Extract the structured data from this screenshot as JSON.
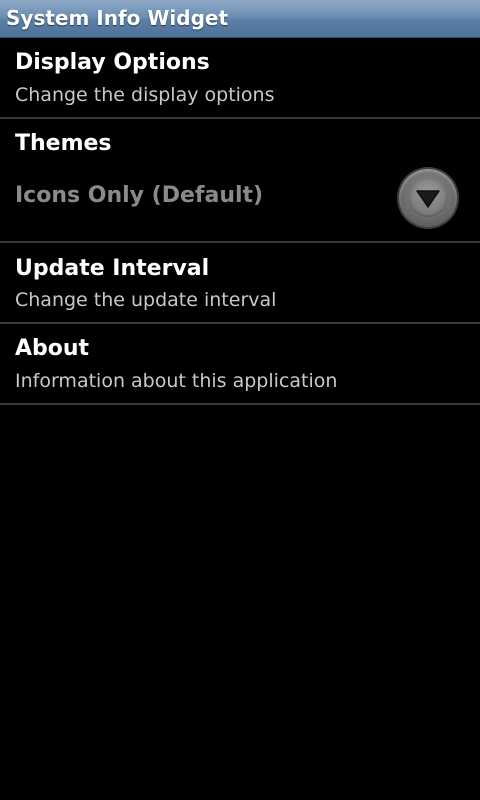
{
  "app": {
    "title": "System Info Widget"
  },
  "preferences": {
    "display_options": {
      "title": "Display Options",
      "summary": "Change the display options"
    },
    "themes": {
      "title": "Themes",
      "value": "Icons Only (Default)",
      "icon": "dropdown-arrow-icon"
    },
    "update_interval": {
      "title": "Update Interval",
      "summary": "Change the update interval"
    },
    "about": {
      "title": "About",
      "summary": "Information about this application"
    }
  },
  "colors": {
    "titlebar": "#6d8fb4",
    "background": "#000000",
    "divider": "#3a3a3a",
    "summary_text": "#c8c8c8",
    "disabled_value": "#8a8a8a"
  }
}
